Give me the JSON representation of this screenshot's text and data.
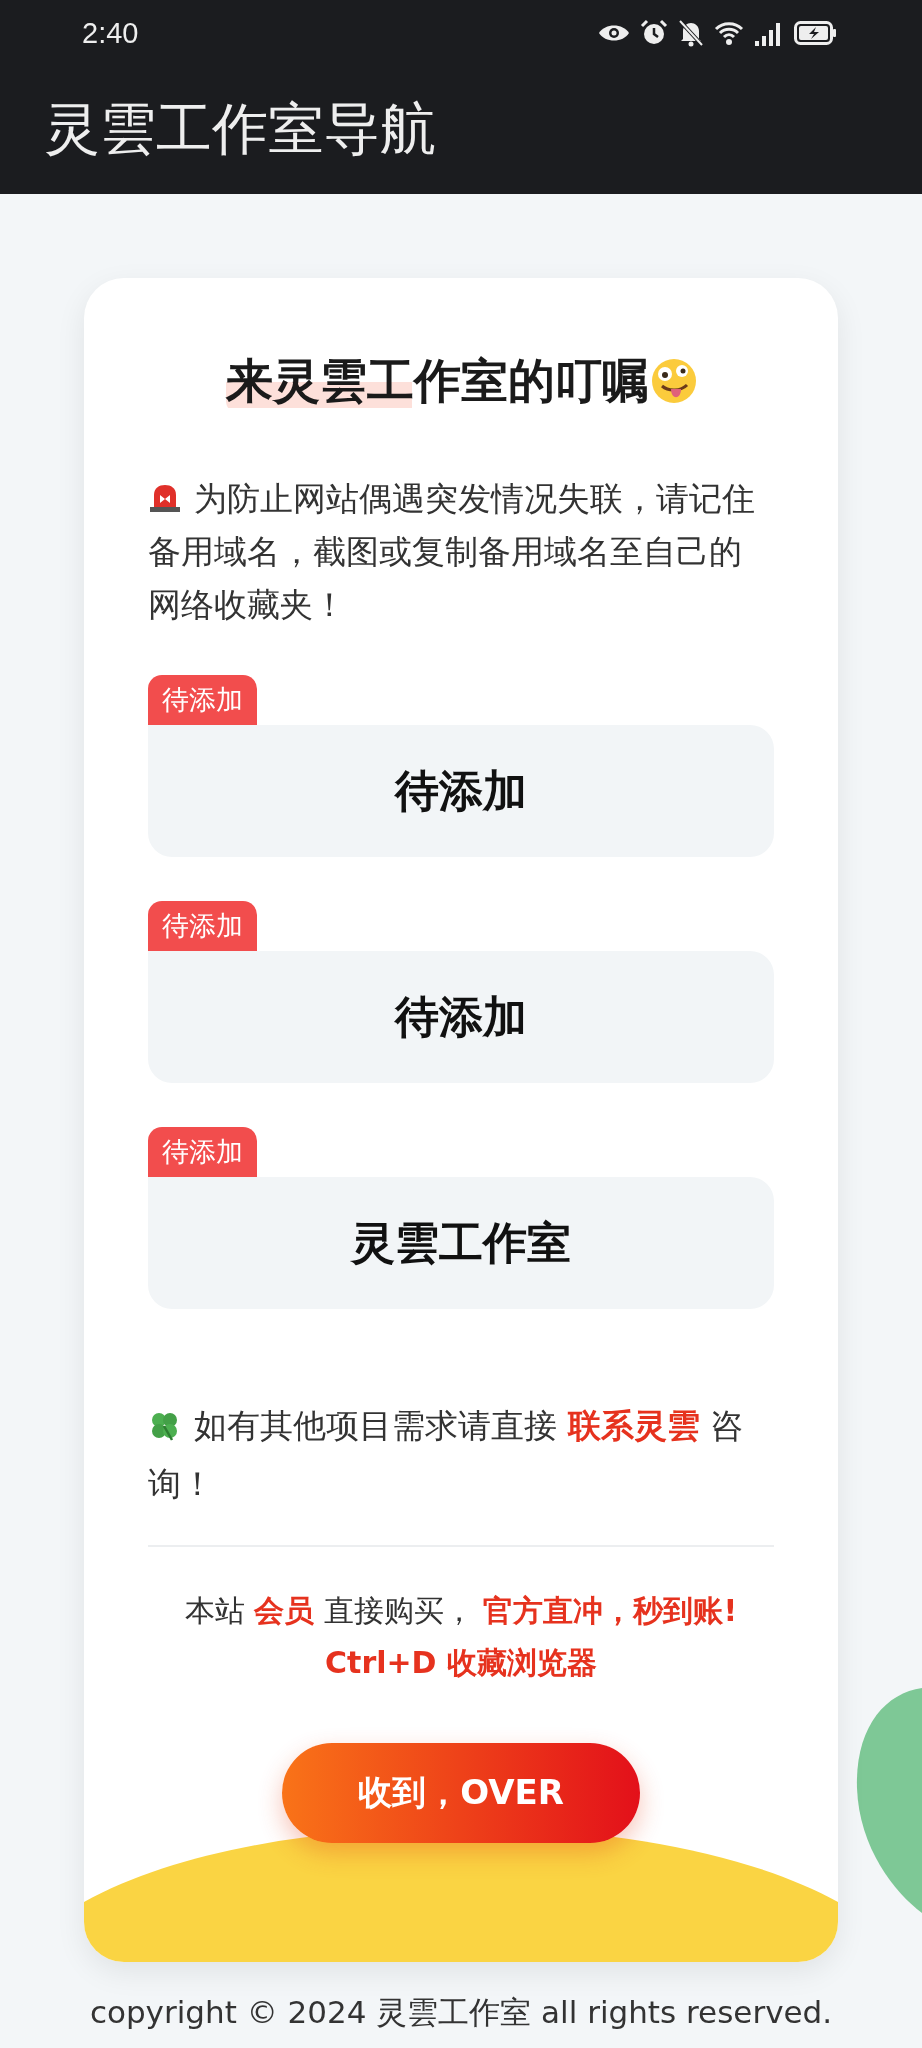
{
  "status_bar": {
    "time": "2:40"
  },
  "app_bar": {
    "title": "灵雲工作室导航"
  },
  "notice": {
    "title": "来灵雲工作室的叮嘱",
    "message": "为防止网站偶遇突发情况失联，请记住备用域名，截图或复制备用域名至自己的网络收藏夹！"
  },
  "links": [
    {
      "tag": "待添加",
      "label": "待添加"
    },
    {
      "tag": "待添加",
      "label": "待添加"
    },
    {
      "tag": "待添加",
      "label": "灵雲工作室"
    }
  ],
  "contact": {
    "before": "如有其他项目需求请直接",
    "link": "联系灵雲",
    "after": "咨询！"
  },
  "promo": {
    "line_1": "本站 **会员** 直接购买， **官方直冲，秒到账!**",
    "line_2": "Ctrl+D 收藏浏览器"
  },
  "button": {
    "label": "收到，OVER"
  },
  "footer": {
    "copyright": "copyright © 2024 灵雲工作室 all rights reserved."
  }
}
